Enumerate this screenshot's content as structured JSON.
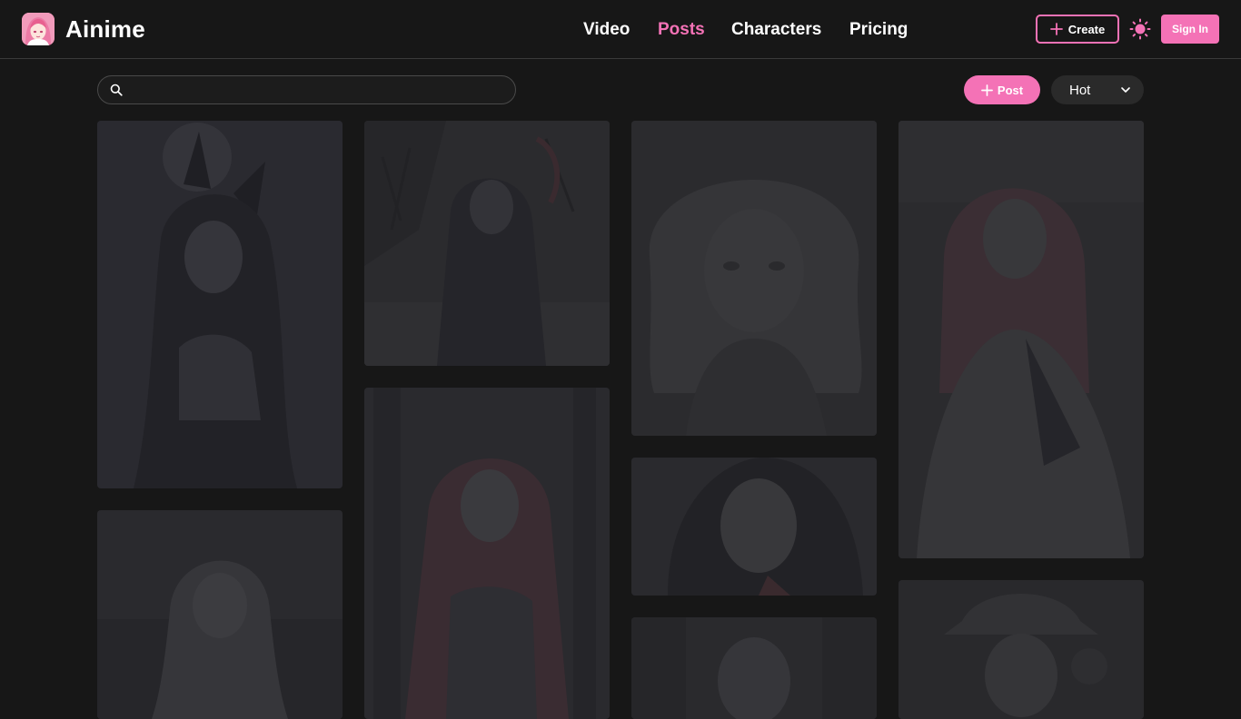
{
  "header": {
    "brand": "Ainime",
    "nav": [
      {
        "label": "Video",
        "active": false
      },
      {
        "label": "Posts",
        "active": true
      },
      {
        "label": "Characters",
        "active": false
      },
      {
        "label": "Pricing",
        "active": false
      }
    ],
    "create_label": "Create",
    "signin_label": "Sign In"
  },
  "toolbar": {
    "search_value": "",
    "post_label": "Post",
    "sort_value": "Hot"
  },
  "colors": {
    "accent": "#f472b6",
    "background": "#171717",
    "card": "#26262a"
  },
  "icons": {
    "logo": "anime-avatar-logo",
    "create": "plus-icon",
    "theme": "sun-icon",
    "search": "search-icon",
    "post": "plus-icon",
    "sort": "chevron-down-icon"
  }
}
